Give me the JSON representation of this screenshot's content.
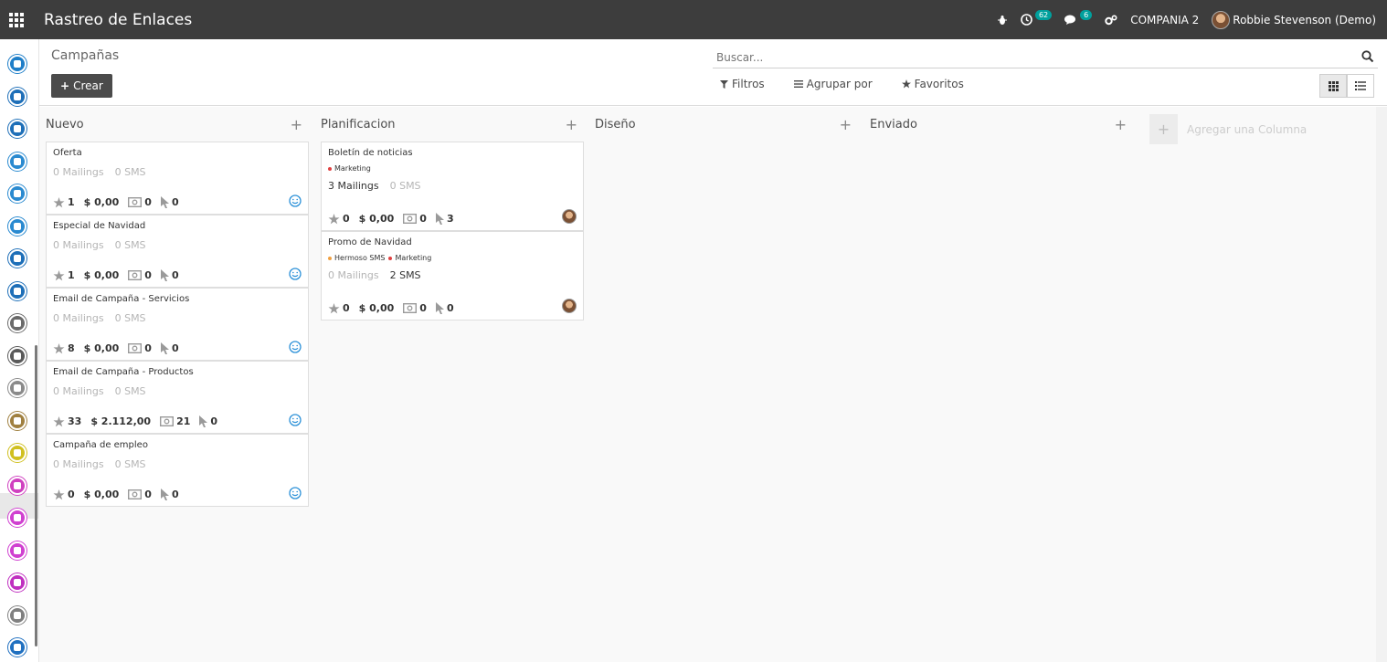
{
  "header": {
    "app_title": "Rastreo de Enlaces",
    "activity_badge": "62",
    "messages_badge": "6",
    "company": "COMPANIA 2",
    "user": "Robbie Stevenson (Demo)"
  },
  "sidebar": {
    "apps": [
      {
        "icon": "contacts-icon",
        "color": "#1e7ec8"
      },
      {
        "icon": "document-icon",
        "color": "#1e6fb8"
      },
      {
        "icon": "team-icon",
        "color": "#1e6fb8"
      },
      {
        "icon": "website-icon",
        "color": "#2a8ad0"
      },
      {
        "icon": "globe-icon",
        "color": "#2a8ad0"
      },
      {
        "icon": "car-icon",
        "color": "#2a8ad0"
      },
      {
        "icon": "rocket-icon",
        "color": "#1e6fb8"
      },
      {
        "icon": "van-icon",
        "color": "#1e6fb8"
      },
      {
        "icon": "settings-gear-icon",
        "color": "#6a6a6a"
      },
      {
        "icon": "tools-icon",
        "color": "#5a5a5a"
      },
      {
        "icon": "calendar-icon",
        "color": "#8a8a8a"
      },
      {
        "icon": "badge-icon",
        "color": "#a08040"
      },
      {
        "icon": "board-icon",
        "color": "#d0c020"
      },
      {
        "icon": "survey-icon",
        "color": "#d040c0"
      },
      {
        "icon": "link-tracker-icon",
        "color": "#d040d0"
      },
      {
        "icon": "mail-icon",
        "color": "#d040d0"
      },
      {
        "icon": "sms-icon",
        "color": "#c030c0"
      },
      {
        "icon": "marketing-icon",
        "color": "#808080"
      },
      {
        "icon": "screen-icon",
        "color": "#2070c0"
      }
    ]
  },
  "control_panel": {
    "breadcrumb": "Campañas",
    "create_label": "Crear",
    "search_placeholder": "Buscar...",
    "filters_label": "Filtros",
    "group_by_label": "Agrupar por",
    "favorites_label": "Favoritos"
  },
  "kanban": {
    "columns": [
      {
        "title": "Nuevo",
        "cards": [
          {
            "title": "Oferta",
            "mailings": "0 Mailings",
            "sms": "0 SMS",
            "stars": "1",
            "revenue": "$ 0,00",
            "quotes": "0",
            "clicks": "0"
          },
          {
            "title": "Especial de Navidad",
            "mailings": "0 Mailings",
            "sms": "0 SMS",
            "stars": "1",
            "revenue": "$ 0,00",
            "quotes": "0",
            "clicks": "0"
          },
          {
            "title": "Email de Campaña - Servicios",
            "mailings": "0 Mailings",
            "sms": "0 SMS",
            "stars": "8",
            "revenue": "$ 0,00",
            "quotes": "0",
            "clicks": "0"
          },
          {
            "title": "Email de Campaña - Productos",
            "mailings": "0 Mailings",
            "sms": "0 SMS",
            "stars": "33",
            "revenue": "$ 2.112,00",
            "quotes": "21",
            "clicks": "0"
          },
          {
            "title": "Campaña de empleo",
            "mailings": "0 Mailings",
            "sms": "0 SMS",
            "stars": "0",
            "revenue": "$ 0,00",
            "quotes": "0",
            "clicks": "0"
          }
        ]
      },
      {
        "title": "Planificacion",
        "cards": [
          {
            "title": "Boletín de noticias",
            "tags": [
              {
                "label": "Marketing",
                "color": "#e04040"
              }
            ],
            "mailings": "3 Mailings",
            "sms": "0 SMS",
            "stars": "0",
            "revenue": "$ 0,00",
            "quotes": "0",
            "clicks": "3"
          },
          {
            "title": "Promo de Navidad",
            "tags": [
              {
                "label": "Hermoso SMS",
                "color": "#f0a040"
              },
              {
                "label": "Marketing",
                "color": "#e04040"
              }
            ],
            "mailings": "0 Mailings",
            "sms": "2 SMS",
            "stars": "0",
            "revenue": "$ 0,00",
            "quotes": "0",
            "clicks": "0"
          }
        ]
      },
      {
        "title": "Diseño",
        "cards": []
      },
      {
        "title": "Enviado",
        "cards": []
      }
    ],
    "add_column_label": "Agregar una Columna"
  }
}
